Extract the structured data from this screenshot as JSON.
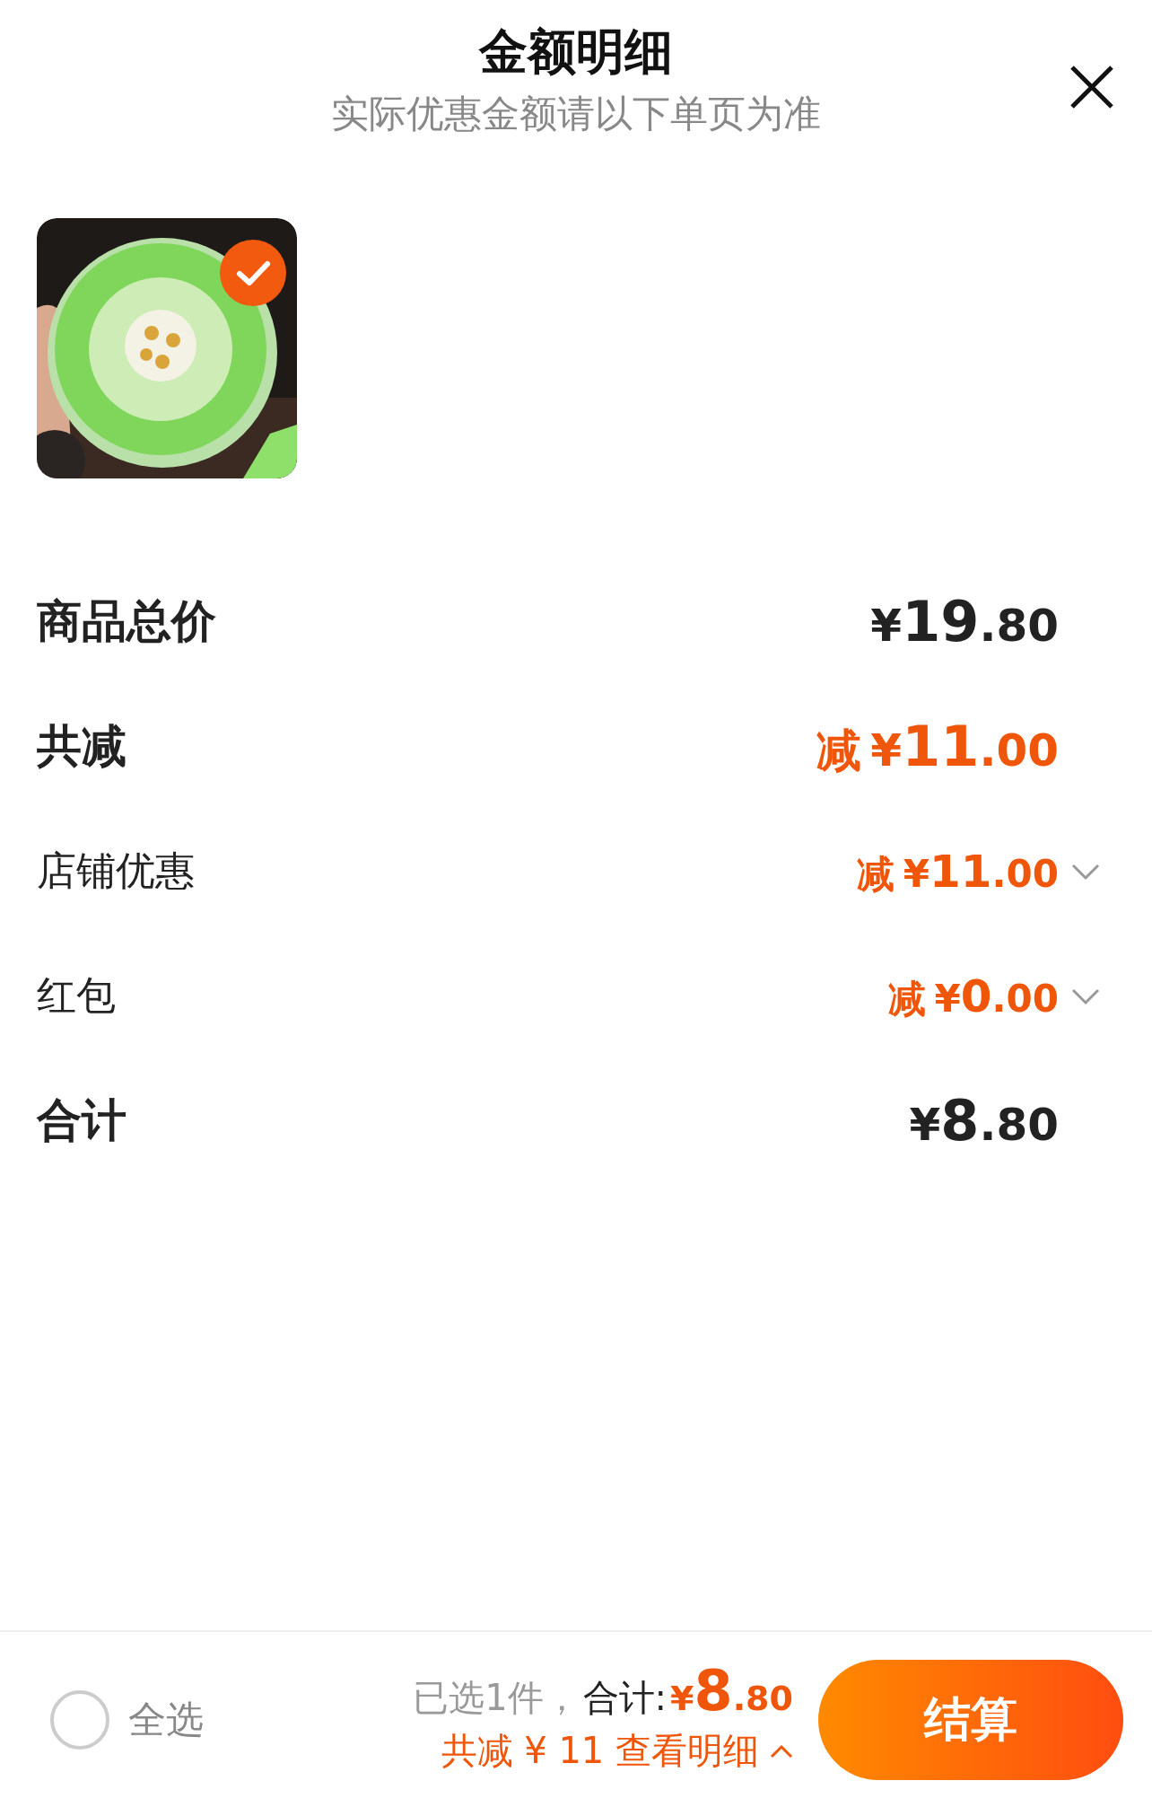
{
  "header": {
    "title": "金额明细",
    "subtitle": "实际优惠金额请以下单页为准"
  },
  "product": {
    "kind": "picture",
    "selected": true
  },
  "rows": [
    {
      "kind": "total",
      "label": "商品总价",
      "amount": {
        "symbol": "¥",
        "integer": "19",
        "decimal": ".80"
      }
    },
    {
      "kind": "saving",
      "label": "共减",
      "amount": {
        "prefix": "减",
        "symbol": "¥",
        "integer": "11",
        "decimal": ".00"
      }
    },
    {
      "kind": "discount",
      "label": "店铺优惠",
      "amount": {
        "prefix": "减",
        "symbol": "¥",
        "integer": "11",
        "decimal": ".00"
      }
    },
    {
      "kind": "discount",
      "label": "红包",
      "amount": {
        "prefix": "减",
        "symbol": "¥",
        "integer": "0",
        "decimal": ".00"
      }
    },
    {
      "kind": "total",
      "label": "合计",
      "amount": {
        "symbol": "¥",
        "integer": "8",
        "decimal": ".80"
      }
    }
  ],
  "bottom_bar": {
    "select_all": {
      "label": "全选",
      "checked": false
    },
    "count_text": "已选1件，",
    "total_label": "合计:",
    "total": {
      "symbol": "¥",
      "integer": "8",
      "decimal": ".80"
    },
    "details_link": "共减 ¥ 11 查看明细",
    "checkout_button": "结算"
  }
}
